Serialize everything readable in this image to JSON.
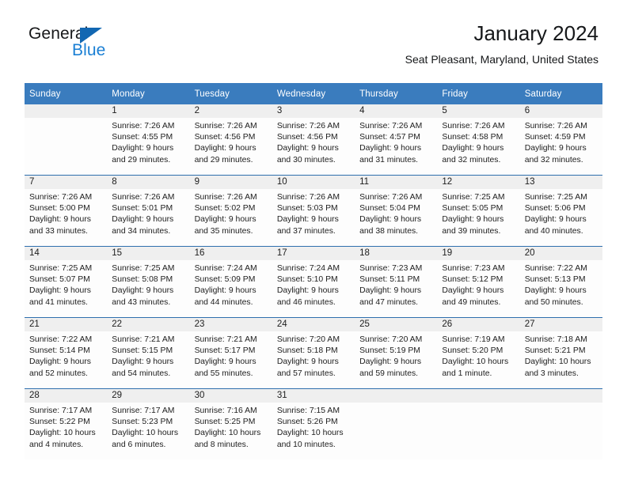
{
  "brand": {
    "name_top": "General",
    "name_bottom": "Blue",
    "accent_color": "#1a7fd4",
    "triangle_color": "#1267b2"
  },
  "header": {
    "title": "January 2024",
    "location": "Seat Pleasant, Maryland, United States"
  },
  "calendar": {
    "header_color": "#3a7cbe",
    "weekday_headers": [
      "Sunday",
      "Monday",
      "Tuesday",
      "Wednesday",
      "Thursday",
      "Friday",
      "Saturday"
    ],
    "weeks": [
      [
        {
          "day": "",
          "sunrise": "",
          "sunset": "",
          "daylight_line1": "",
          "daylight_line2": ""
        },
        {
          "day": "1",
          "sunrise": "Sunrise: 7:26 AM",
          "sunset": "Sunset: 4:55 PM",
          "daylight_line1": "Daylight: 9 hours",
          "daylight_line2": "and 29 minutes."
        },
        {
          "day": "2",
          "sunrise": "Sunrise: 7:26 AM",
          "sunset": "Sunset: 4:56 PM",
          "daylight_line1": "Daylight: 9 hours",
          "daylight_line2": "and 29 minutes."
        },
        {
          "day": "3",
          "sunrise": "Sunrise: 7:26 AM",
          "sunset": "Sunset: 4:56 PM",
          "daylight_line1": "Daylight: 9 hours",
          "daylight_line2": "and 30 minutes."
        },
        {
          "day": "4",
          "sunrise": "Sunrise: 7:26 AM",
          "sunset": "Sunset: 4:57 PM",
          "daylight_line1": "Daylight: 9 hours",
          "daylight_line2": "and 31 minutes."
        },
        {
          "day": "5",
          "sunrise": "Sunrise: 7:26 AM",
          "sunset": "Sunset: 4:58 PM",
          "daylight_line1": "Daylight: 9 hours",
          "daylight_line2": "and 32 minutes."
        },
        {
          "day": "6",
          "sunrise": "Sunrise: 7:26 AM",
          "sunset": "Sunset: 4:59 PM",
          "daylight_line1": "Daylight: 9 hours",
          "daylight_line2": "and 32 minutes."
        }
      ],
      [
        {
          "day": "7",
          "sunrise": "Sunrise: 7:26 AM",
          "sunset": "Sunset: 5:00 PM",
          "daylight_line1": "Daylight: 9 hours",
          "daylight_line2": "and 33 minutes."
        },
        {
          "day": "8",
          "sunrise": "Sunrise: 7:26 AM",
          "sunset": "Sunset: 5:01 PM",
          "daylight_line1": "Daylight: 9 hours",
          "daylight_line2": "and 34 minutes."
        },
        {
          "day": "9",
          "sunrise": "Sunrise: 7:26 AM",
          "sunset": "Sunset: 5:02 PM",
          "daylight_line1": "Daylight: 9 hours",
          "daylight_line2": "and 35 minutes."
        },
        {
          "day": "10",
          "sunrise": "Sunrise: 7:26 AM",
          "sunset": "Sunset: 5:03 PM",
          "daylight_line1": "Daylight: 9 hours",
          "daylight_line2": "and 37 minutes."
        },
        {
          "day": "11",
          "sunrise": "Sunrise: 7:26 AM",
          "sunset": "Sunset: 5:04 PM",
          "daylight_line1": "Daylight: 9 hours",
          "daylight_line2": "and 38 minutes."
        },
        {
          "day": "12",
          "sunrise": "Sunrise: 7:25 AM",
          "sunset": "Sunset: 5:05 PM",
          "daylight_line1": "Daylight: 9 hours",
          "daylight_line2": "and 39 minutes."
        },
        {
          "day": "13",
          "sunrise": "Sunrise: 7:25 AM",
          "sunset": "Sunset: 5:06 PM",
          "daylight_line1": "Daylight: 9 hours",
          "daylight_line2": "and 40 minutes."
        }
      ],
      [
        {
          "day": "14",
          "sunrise": "Sunrise: 7:25 AM",
          "sunset": "Sunset: 5:07 PM",
          "daylight_line1": "Daylight: 9 hours",
          "daylight_line2": "and 41 minutes."
        },
        {
          "day": "15",
          "sunrise": "Sunrise: 7:25 AM",
          "sunset": "Sunset: 5:08 PM",
          "daylight_line1": "Daylight: 9 hours",
          "daylight_line2": "and 43 minutes."
        },
        {
          "day": "16",
          "sunrise": "Sunrise: 7:24 AM",
          "sunset": "Sunset: 5:09 PM",
          "daylight_line1": "Daylight: 9 hours",
          "daylight_line2": "and 44 minutes."
        },
        {
          "day": "17",
          "sunrise": "Sunrise: 7:24 AM",
          "sunset": "Sunset: 5:10 PM",
          "daylight_line1": "Daylight: 9 hours",
          "daylight_line2": "and 46 minutes."
        },
        {
          "day": "18",
          "sunrise": "Sunrise: 7:23 AM",
          "sunset": "Sunset: 5:11 PM",
          "daylight_line1": "Daylight: 9 hours",
          "daylight_line2": "and 47 minutes."
        },
        {
          "day": "19",
          "sunrise": "Sunrise: 7:23 AM",
          "sunset": "Sunset: 5:12 PM",
          "daylight_line1": "Daylight: 9 hours",
          "daylight_line2": "and 49 minutes."
        },
        {
          "day": "20",
          "sunrise": "Sunrise: 7:22 AM",
          "sunset": "Sunset: 5:13 PM",
          "daylight_line1": "Daylight: 9 hours",
          "daylight_line2": "and 50 minutes."
        }
      ],
      [
        {
          "day": "21",
          "sunrise": "Sunrise: 7:22 AM",
          "sunset": "Sunset: 5:14 PM",
          "daylight_line1": "Daylight: 9 hours",
          "daylight_line2": "and 52 minutes."
        },
        {
          "day": "22",
          "sunrise": "Sunrise: 7:21 AM",
          "sunset": "Sunset: 5:15 PM",
          "daylight_line1": "Daylight: 9 hours",
          "daylight_line2": "and 54 minutes."
        },
        {
          "day": "23",
          "sunrise": "Sunrise: 7:21 AM",
          "sunset": "Sunset: 5:17 PM",
          "daylight_line1": "Daylight: 9 hours",
          "daylight_line2": "and 55 minutes."
        },
        {
          "day": "24",
          "sunrise": "Sunrise: 7:20 AM",
          "sunset": "Sunset: 5:18 PM",
          "daylight_line1": "Daylight: 9 hours",
          "daylight_line2": "and 57 minutes."
        },
        {
          "day": "25",
          "sunrise": "Sunrise: 7:20 AM",
          "sunset": "Sunset: 5:19 PM",
          "daylight_line1": "Daylight: 9 hours",
          "daylight_line2": "and 59 minutes."
        },
        {
          "day": "26",
          "sunrise": "Sunrise: 7:19 AM",
          "sunset": "Sunset: 5:20 PM",
          "daylight_line1": "Daylight: 10 hours",
          "daylight_line2": "and 1 minute."
        },
        {
          "day": "27",
          "sunrise": "Sunrise: 7:18 AM",
          "sunset": "Sunset: 5:21 PM",
          "daylight_line1": "Daylight: 10 hours",
          "daylight_line2": "and 3 minutes."
        }
      ],
      [
        {
          "day": "28",
          "sunrise": "Sunrise: 7:17 AM",
          "sunset": "Sunset: 5:22 PM",
          "daylight_line1": "Daylight: 10 hours",
          "daylight_line2": "and 4 minutes."
        },
        {
          "day": "29",
          "sunrise": "Sunrise: 7:17 AM",
          "sunset": "Sunset: 5:23 PM",
          "daylight_line1": "Daylight: 10 hours",
          "daylight_line2": "and 6 minutes."
        },
        {
          "day": "30",
          "sunrise": "Sunrise: 7:16 AM",
          "sunset": "Sunset: 5:25 PM",
          "daylight_line1": "Daylight: 10 hours",
          "daylight_line2": "and 8 minutes."
        },
        {
          "day": "31",
          "sunrise": "Sunrise: 7:15 AM",
          "sunset": "Sunset: 5:26 PM",
          "daylight_line1": "Daylight: 10 hours",
          "daylight_line2": "and 10 minutes."
        },
        {
          "day": "",
          "sunrise": "",
          "sunset": "",
          "daylight_line1": "",
          "daylight_line2": ""
        },
        {
          "day": "",
          "sunrise": "",
          "sunset": "",
          "daylight_line1": "",
          "daylight_line2": ""
        },
        {
          "day": "",
          "sunrise": "",
          "sunset": "",
          "daylight_line1": "",
          "daylight_line2": ""
        }
      ]
    ]
  }
}
